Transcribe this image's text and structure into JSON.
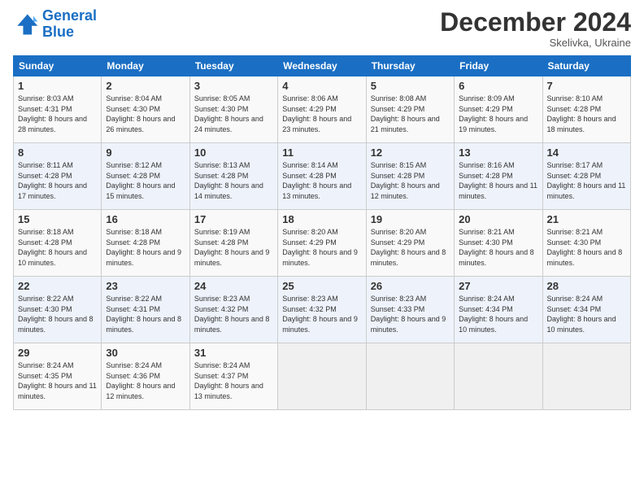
{
  "header": {
    "logo_line1": "General",
    "logo_line2": "Blue",
    "month": "December 2024",
    "location": "Skelivka, Ukraine"
  },
  "days_of_week": [
    "Sunday",
    "Monday",
    "Tuesday",
    "Wednesday",
    "Thursday",
    "Friday",
    "Saturday"
  ],
  "weeks": [
    [
      {
        "day": "1",
        "sunrise": "8:03 AM",
        "sunset": "4:31 PM",
        "daylight": "8 hours and 28 minutes."
      },
      {
        "day": "2",
        "sunrise": "8:04 AM",
        "sunset": "4:30 PM",
        "daylight": "8 hours and 26 minutes."
      },
      {
        "day": "3",
        "sunrise": "8:05 AM",
        "sunset": "4:30 PM",
        "daylight": "8 hours and 24 minutes."
      },
      {
        "day": "4",
        "sunrise": "8:06 AM",
        "sunset": "4:29 PM",
        "daylight": "8 hours and 23 minutes."
      },
      {
        "day": "5",
        "sunrise": "8:08 AM",
        "sunset": "4:29 PM",
        "daylight": "8 hours and 21 minutes."
      },
      {
        "day": "6",
        "sunrise": "8:09 AM",
        "sunset": "4:29 PM",
        "daylight": "8 hours and 19 minutes."
      },
      {
        "day": "7",
        "sunrise": "8:10 AM",
        "sunset": "4:28 PM",
        "daylight": "8 hours and 18 minutes."
      }
    ],
    [
      {
        "day": "8",
        "sunrise": "8:11 AM",
        "sunset": "4:28 PM",
        "daylight": "8 hours and 17 minutes."
      },
      {
        "day": "9",
        "sunrise": "8:12 AM",
        "sunset": "4:28 PM",
        "daylight": "8 hours and 15 minutes."
      },
      {
        "day": "10",
        "sunrise": "8:13 AM",
        "sunset": "4:28 PM",
        "daylight": "8 hours and 14 minutes."
      },
      {
        "day": "11",
        "sunrise": "8:14 AM",
        "sunset": "4:28 PM",
        "daylight": "8 hours and 13 minutes."
      },
      {
        "day": "12",
        "sunrise": "8:15 AM",
        "sunset": "4:28 PM",
        "daylight": "8 hours and 12 minutes."
      },
      {
        "day": "13",
        "sunrise": "8:16 AM",
        "sunset": "4:28 PM",
        "daylight": "8 hours and 11 minutes."
      },
      {
        "day": "14",
        "sunrise": "8:17 AM",
        "sunset": "4:28 PM",
        "daylight": "8 hours and 11 minutes."
      }
    ],
    [
      {
        "day": "15",
        "sunrise": "8:18 AM",
        "sunset": "4:28 PM",
        "daylight": "8 hours and 10 minutes."
      },
      {
        "day": "16",
        "sunrise": "8:18 AM",
        "sunset": "4:28 PM",
        "daylight": "8 hours and 9 minutes."
      },
      {
        "day": "17",
        "sunrise": "8:19 AM",
        "sunset": "4:28 PM",
        "daylight": "8 hours and 9 minutes."
      },
      {
        "day": "18",
        "sunrise": "8:20 AM",
        "sunset": "4:29 PM",
        "daylight": "8 hours and 9 minutes."
      },
      {
        "day": "19",
        "sunrise": "8:20 AM",
        "sunset": "4:29 PM",
        "daylight": "8 hours and 8 minutes."
      },
      {
        "day": "20",
        "sunrise": "8:21 AM",
        "sunset": "4:30 PM",
        "daylight": "8 hours and 8 minutes."
      },
      {
        "day": "21",
        "sunrise": "8:21 AM",
        "sunset": "4:30 PM",
        "daylight": "8 hours and 8 minutes."
      }
    ],
    [
      {
        "day": "22",
        "sunrise": "8:22 AM",
        "sunset": "4:30 PM",
        "daylight": "8 hours and 8 minutes."
      },
      {
        "day": "23",
        "sunrise": "8:22 AM",
        "sunset": "4:31 PM",
        "daylight": "8 hours and 8 minutes."
      },
      {
        "day": "24",
        "sunrise": "8:23 AM",
        "sunset": "4:32 PM",
        "daylight": "8 hours and 8 minutes."
      },
      {
        "day": "25",
        "sunrise": "8:23 AM",
        "sunset": "4:32 PM",
        "daylight": "8 hours and 9 minutes."
      },
      {
        "day": "26",
        "sunrise": "8:23 AM",
        "sunset": "4:33 PM",
        "daylight": "8 hours and 9 minutes."
      },
      {
        "day": "27",
        "sunrise": "8:24 AM",
        "sunset": "4:34 PM",
        "daylight": "8 hours and 10 minutes."
      },
      {
        "day": "28",
        "sunrise": "8:24 AM",
        "sunset": "4:34 PM",
        "daylight": "8 hours and 10 minutes."
      }
    ],
    [
      {
        "day": "29",
        "sunrise": "8:24 AM",
        "sunset": "4:35 PM",
        "daylight": "8 hours and 11 minutes."
      },
      {
        "day": "30",
        "sunrise": "8:24 AM",
        "sunset": "4:36 PM",
        "daylight": "8 hours and 12 minutes."
      },
      {
        "day": "31",
        "sunrise": "8:24 AM",
        "sunset": "4:37 PM",
        "daylight": "8 hours and 13 minutes."
      },
      null,
      null,
      null,
      null
    ]
  ]
}
